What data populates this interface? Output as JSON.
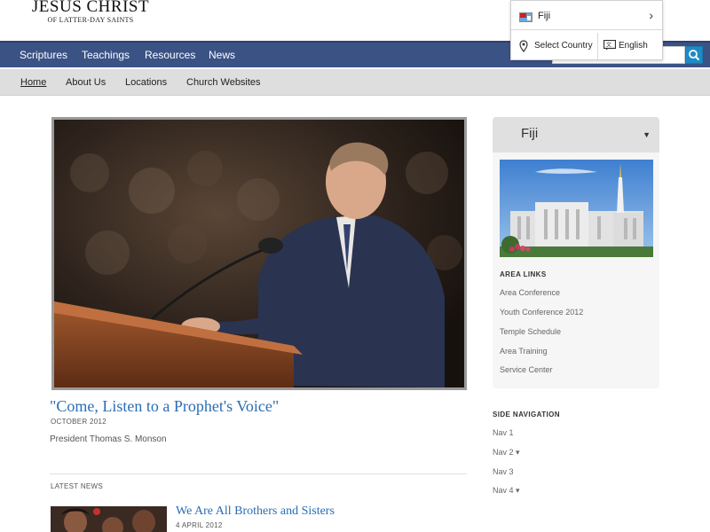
{
  "logo": {
    "line1": "JESUS CHRIST",
    "line2": "OF LATTER-DAY SAINTS"
  },
  "main_nav": [
    "Scriptures",
    "Teachings",
    "Resources",
    "News"
  ],
  "country_popup": {
    "country": "Fiji",
    "select_country": "Select Country",
    "language": "English"
  },
  "search": {
    "placeholder": ""
  },
  "sub_nav": [
    "Home",
    "About Us",
    "Locations",
    "Church Websites"
  ],
  "feature": {
    "title": "\"Come, Listen to a Prophet's Voice\"",
    "date": "OCTOBER 2012",
    "author": "President Thomas S. Monson"
  },
  "latest_news": {
    "label": "LATEST NEWS",
    "items": [
      {
        "title": "We Are All Brothers and Sisters",
        "date": "4 APRIL 2012"
      }
    ]
  },
  "area_panel": {
    "country": "Fiji",
    "section_label": "AREA LINKS",
    "links": [
      "Area Conference",
      "Youth Conference 2012",
      "Temple Schedule",
      "Area Training",
      "Service Center"
    ]
  },
  "side_navigation": {
    "label": "SIDE NAVIGATION",
    "items": [
      "Nav 1",
      "Nav 2 ▾",
      "Nav 3",
      "Nav 4 ▾"
    ]
  },
  "colors": {
    "nav_bg": "#3b5284",
    "link": "#2a6db5",
    "search_btn": "#1f8bc4"
  }
}
